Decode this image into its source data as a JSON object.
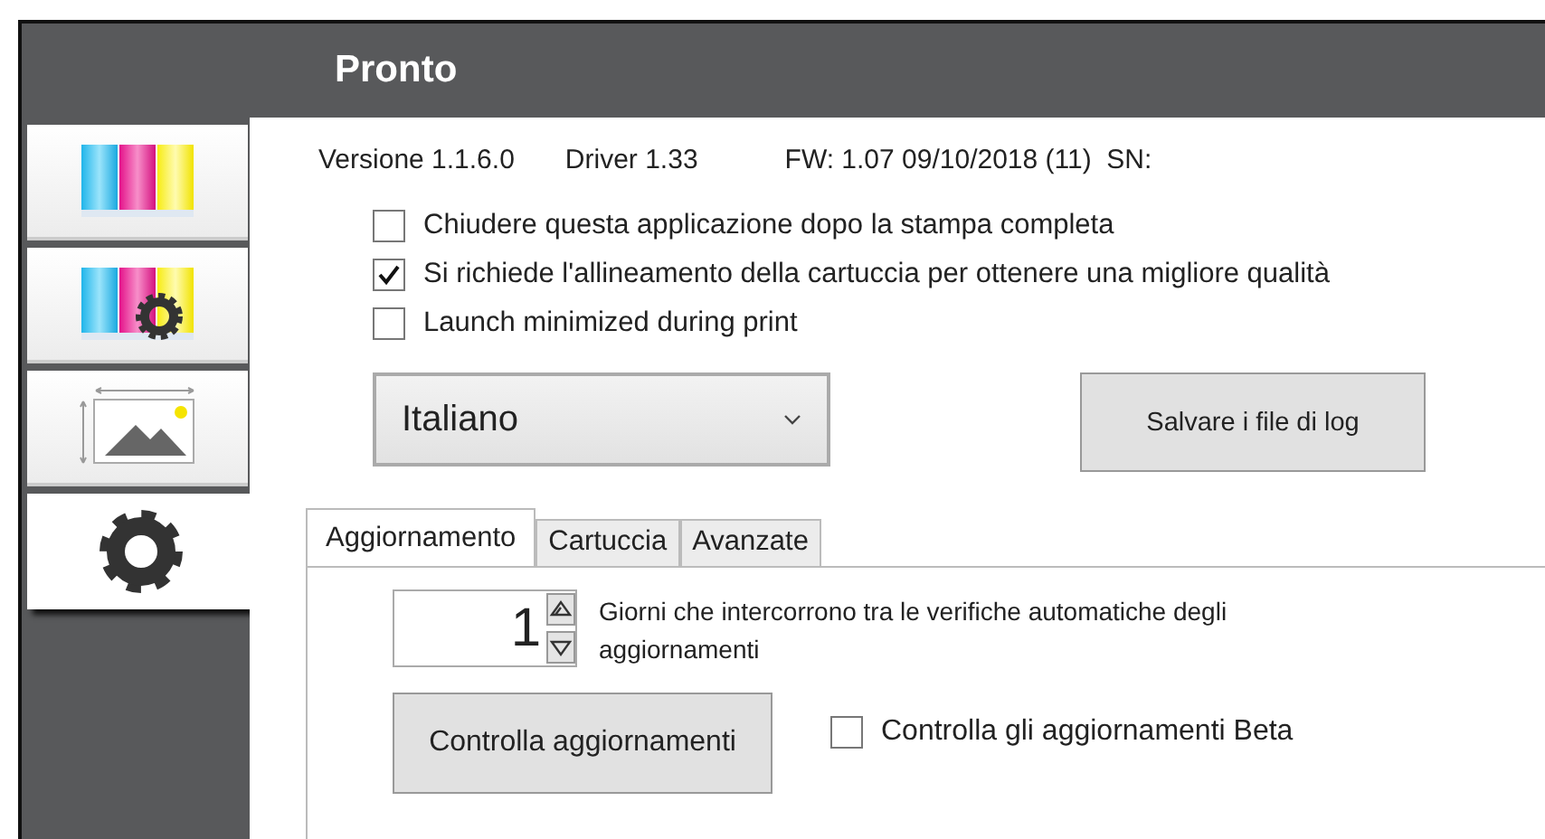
{
  "window": {
    "title": "Pronto"
  },
  "sidebar": {
    "items": [
      {
        "kind": "cmyk",
        "selected": false
      },
      {
        "kind": "cmyk-settings",
        "selected": false
      },
      {
        "kind": "image-size",
        "selected": false
      },
      {
        "kind": "settings",
        "selected": true
      }
    ]
  },
  "info": [
    "Versione 1.1.6.0",
    "Driver 1.33",
    "FW: 1.07 09/10/2018 (11)  SN:"
  ],
  "options": [
    {
      "label": "Chiudere questa applicazione dopo la stampa completa",
      "checked": false
    },
    {
      "label": "Si richiede l'allineamento della cartuccia per ottenere una migliore qualità",
      "checked": true
    },
    {
      "label": "Launch minimized during print",
      "checked": false
    }
  ],
  "language_dropdown": {
    "value": "Italiano"
  },
  "save_logs_button": "Salvare i file di log",
  "tabs": [
    {
      "label": "Aggiornamento",
      "selected": true
    },
    {
      "label": "Cartuccia",
      "selected": false
    },
    {
      "label": "Avanzate",
      "selected": false
    }
  ],
  "update_days": {
    "value": "1",
    "label": "Giorni che intercorrono tra le verifiche automatiche degli aggiornamenti"
  },
  "check_updates_button": "Controlla aggiornamenti",
  "beta_updates": {
    "label": "Controlla gli aggiornamenti Beta",
    "checked": false
  }
}
